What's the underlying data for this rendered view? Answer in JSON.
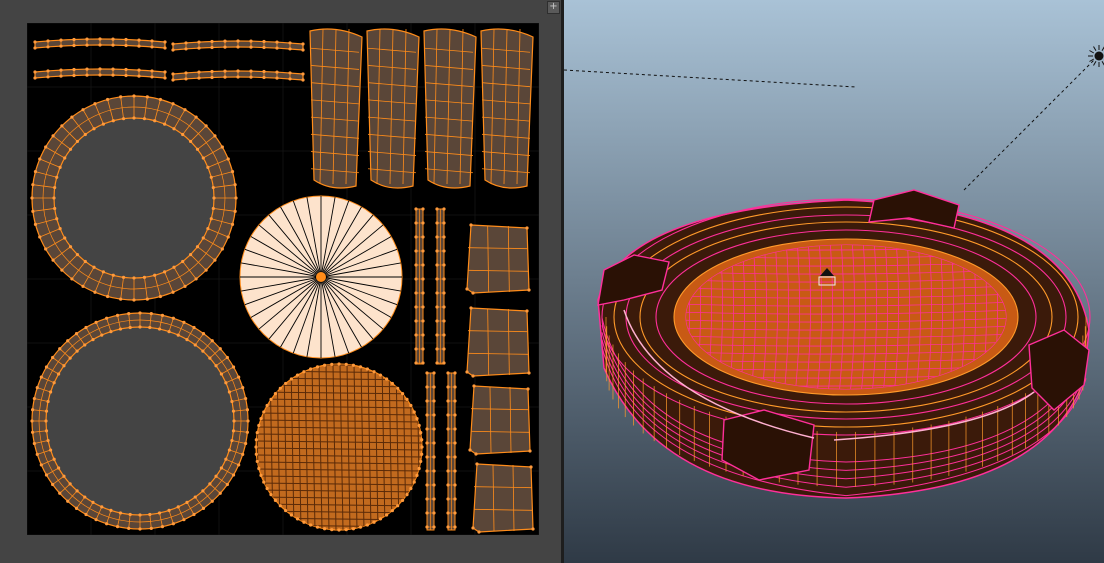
{
  "colors": {
    "uv_face": "#5a4638",
    "uv_edge": "#ff8c1a",
    "uv_point": "#ff9a3c",
    "uv_sheet": "#000000",
    "uv_grid": "#444444",
    "viewport_sky_top": "#a9c2d6",
    "viewport_sky_bottom": "#2f3a46",
    "model_wire": "#ff2f9a",
    "model_inner_wire": "#ff9a2a",
    "model_face": "#3b1a0a",
    "model_cobble": "#c85a14",
    "selected_shell": "#fde3cc"
  },
  "pane_buttons": [
    {
      "icon": "plus-icon",
      "glyph": "+"
    },
    {
      "icon": "move-icon",
      "glyph": "✥"
    }
  ],
  "uv_editor": {
    "shells": [
      "arc-strip",
      "arc-strip",
      "arc-strip",
      "arc-strip",
      "curved-panel",
      "curved-panel",
      "curved-panel",
      "curved-panel",
      "ring",
      "ring",
      "fan-disc",
      "cobble-disc",
      "thin-strip",
      "thin-strip",
      "thin-strip",
      "thin-strip",
      "block",
      "block",
      "block",
      "block"
    ]
  },
  "viewport": {
    "light_icon": "directional-light-icon",
    "camera_icon": "camera-icon"
  }
}
